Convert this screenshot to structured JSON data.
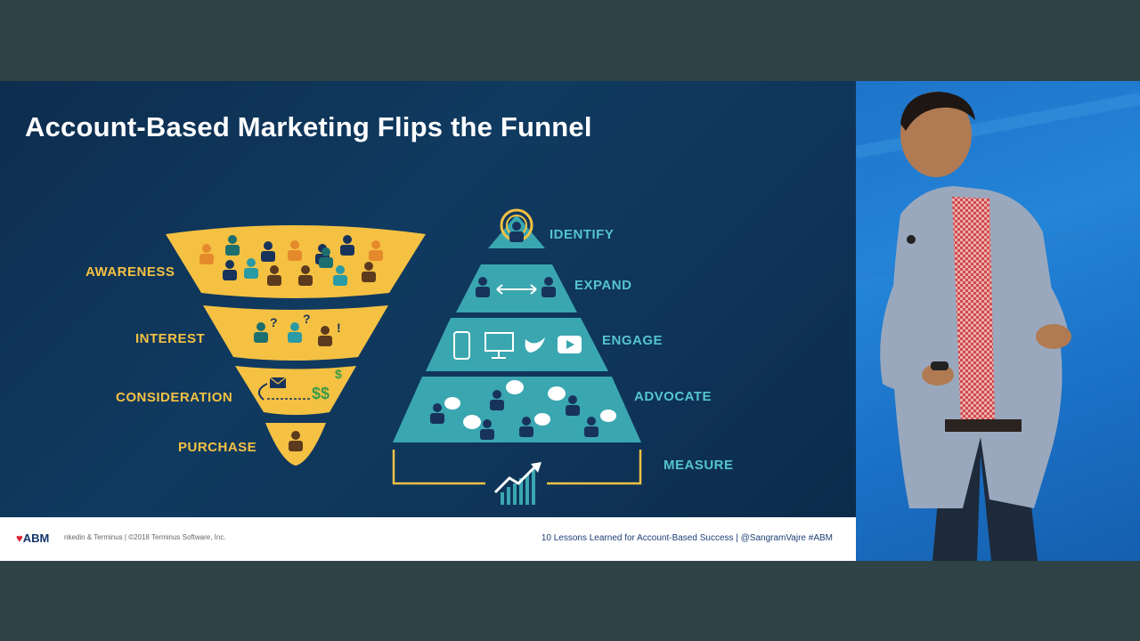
{
  "slide": {
    "title": "Account-Based Marketing Flips the Funnel",
    "funnel_stages": [
      "AWARENESS",
      "INTEREST",
      "CONSIDERATION",
      "PURCHASE"
    ],
    "pyramid_stages": [
      "IDENTIFY",
      "EXPAND",
      "ENGAGE",
      "ADVOCATE",
      "MEASURE"
    ],
    "colors": {
      "funnel": "#f5c143",
      "pyramid": "#3aa6b0",
      "funnel_label": "#f5c143",
      "pyramid_label": "#55c4cf",
      "background": "#0f3458"
    }
  },
  "footer": {
    "logo_text": "ABM",
    "left_text": "nkedin & Terminus  |  ©2018 Terminus Software, Inc.",
    "right_text": "10 Lessons Learned for Account-Based Success | @SangramVajre #ABM"
  },
  "icons": [
    "person-icon",
    "smartphone-icon",
    "monitor-icon",
    "twitter-icon",
    "youtube-icon",
    "chat-bubble-icon",
    "arrows-icon",
    "envelope-icon",
    "dollar-icon",
    "growth-chart-icon",
    "target-icon"
  ]
}
